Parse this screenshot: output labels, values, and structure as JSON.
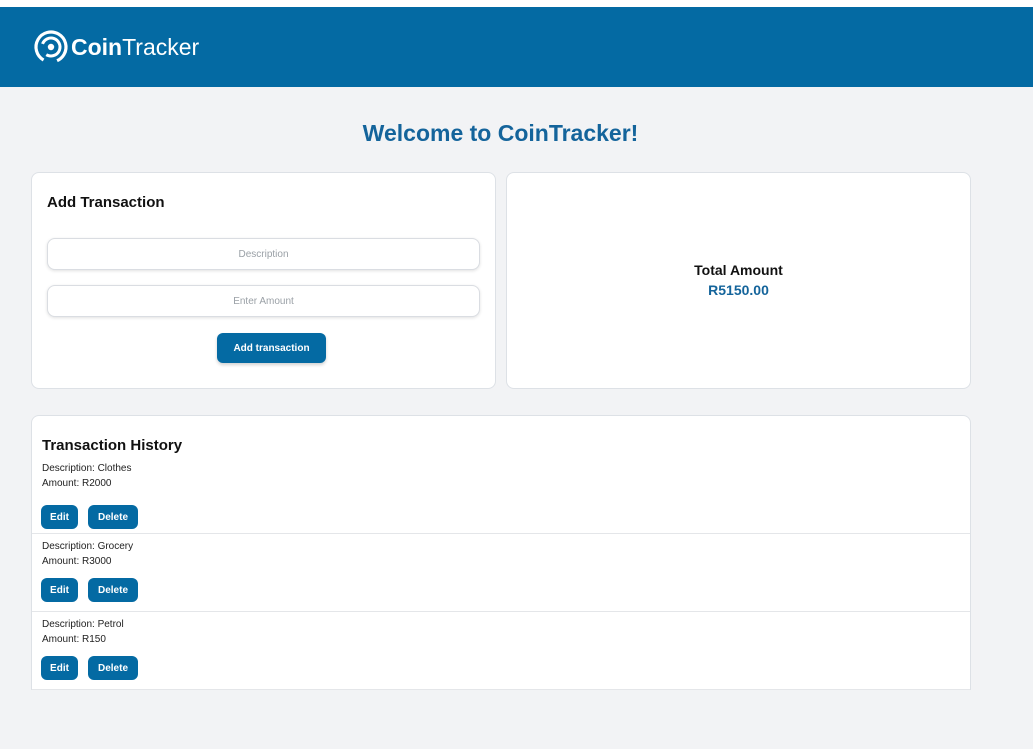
{
  "header": {
    "logo_icon": "coin-spiral-icon",
    "brand_bold": "Coin",
    "brand_rest": "Tracker"
  },
  "welcome_title": "Welcome to CoinTracker!",
  "add_form": {
    "title": "Add Transaction",
    "description_value": "",
    "description_placeholder": "Description",
    "amount_value": "",
    "amount_placeholder": "Enter Amount",
    "submit_label": "Add transaction"
  },
  "total": {
    "label": "Total Amount",
    "value": "R5150.00"
  },
  "history": {
    "title": "Transaction History",
    "edit_label": "Edit",
    "delete_label": "Delete",
    "items": [
      {
        "description": "Description: Clothes",
        "amount": "Amount: R2000"
      },
      {
        "description": "Description: Grocery",
        "amount": "Amount: R3000"
      },
      {
        "description": "Description: Petrol",
        "amount": "Amount: R150"
      }
    ]
  },
  "colors": {
    "brand": "#046aa3",
    "accent_text": "#14649b",
    "background": "#f2f3f5"
  }
}
